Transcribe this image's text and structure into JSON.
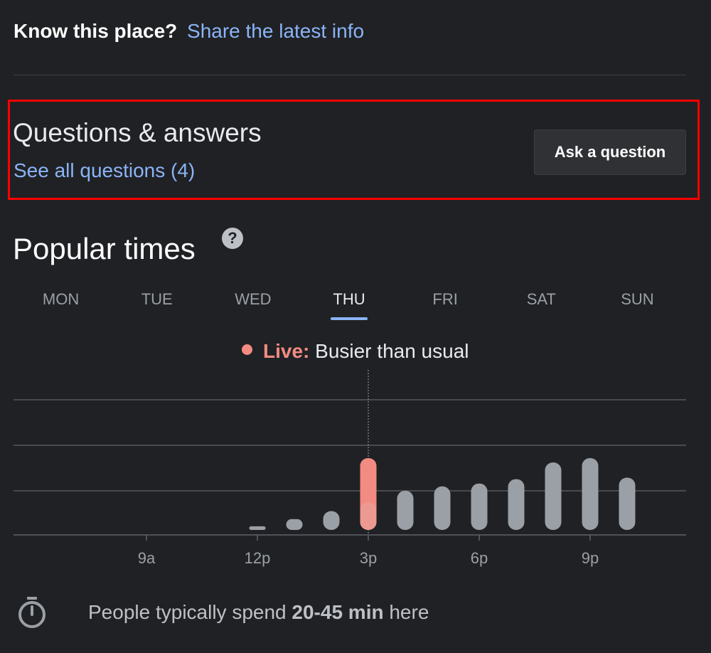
{
  "know": {
    "question": "Know this place?",
    "link": "Share the latest info"
  },
  "qa": {
    "title": "Questions & answers",
    "link": "See all questions (4)",
    "ask_button": "Ask a question"
  },
  "popular": {
    "title": "Popular times",
    "help_icon": "?",
    "days": [
      "MON",
      "TUE",
      "WED",
      "THU",
      "FRI",
      "SAT",
      "SUN"
    ],
    "active_day": "THU",
    "live_label": "Live:",
    "live_text": "Busier than usual"
  },
  "chart_data": {
    "type": "bar",
    "x_tick_labels": [
      "9a",
      "12p",
      "3p",
      "6p",
      "9p"
    ],
    "hours": [
      12,
      13,
      14,
      15,
      16,
      17,
      18,
      19,
      20,
      21,
      22
    ],
    "usual_values": [
      5,
      15,
      26,
      38,
      54,
      60,
      64,
      70,
      93,
      99,
      72
    ],
    "live_hour": 15,
    "live_value": 99,
    "grid": true,
    "colors": {
      "bar": "#9aa0a6",
      "live": "#f28b82",
      "live_usual": "#e8a59f",
      "grid": "#5f6368"
    }
  },
  "spend": {
    "prefix": "People typically spend ",
    "duration": "20-45 min",
    "suffix": " here",
    "icon": "timer-icon"
  }
}
